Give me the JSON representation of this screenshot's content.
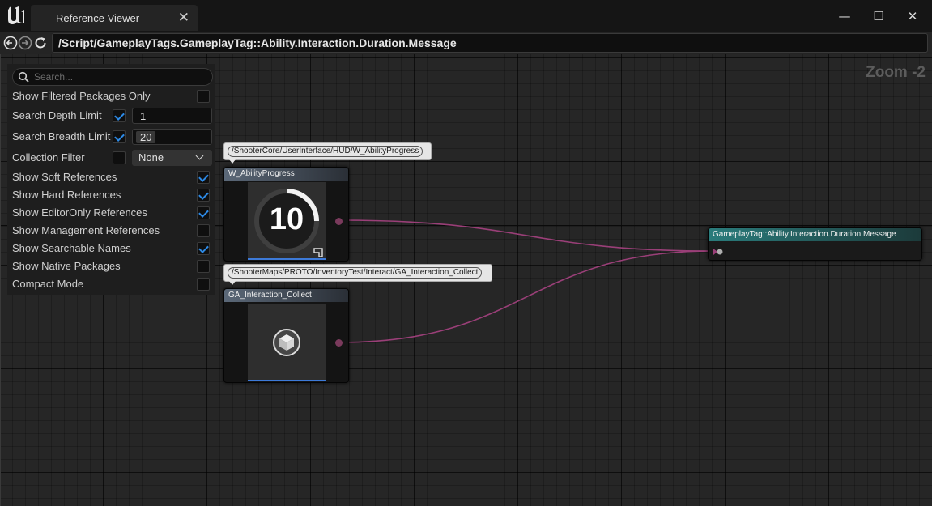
{
  "window": {
    "tab_title": "Reference Viewer",
    "close_tab": "✕",
    "minimize": "—",
    "maximize": "☐",
    "close": "✕"
  },
  "address": {
    "path": "/Script/GameplayTags.GameplayTag::Ability.Interaction.Duration.Message"
  },
  "graph": {
    "zoom_label": "Zoom -2"
  },
  "settings": {
    "search_placeholder": "Search...",
    "filtered_packages": {
      "label": "Show Filtered Packages Only",
      "checked": false
    },
    "depth_limit": {
      "label": "Search Depth Limit",
      "checked": true,
      "value": "1"
    },
    "breadth_limit": {
      "label": "Search Breadth Limit",
      "checked": true,
      "value": "20"
    },
    "collection_filter": {
      "label": "Collection Filter",
      "checked": false,
      "value": "None"
    },
    "soft_refs": {
      "label": "Show Soft References",
      "checked": true
    },
    "hard_refs": {
      "label": "Show Hard References",
      "checked": true
    },
    "editor_only_refs": {
      "label": "Show EditorOnly References",
      "checked": true
    },
    "management_refs": {
      "label": "Show Management References",
      "checked": false
    },
    "searchable_names": {
      "label": "Show Searchable Names",
      "checked": true
    },
    "native_packages": {
      "label": "Show Native Packages",
      "checked": false
    },
    "compact_mode": {
      "label": "Compact Mode",
      "checked": false
    }
  },
  "nodes": {
    "ability_progress": {
      "path": "/ShooterCore/UserInterface/HUD/W_AbilityProgress",
      "title": "W_AbilityProgress",
      "thumb_value": "10"
    },
    "interaction_collect": {
      "path": "/ShooterMaps/PROTO/InventoryTest/Interact/GA_Interaction_Collect",
      "title": "GA_Interaction_Collect"
    },
    "gameplay_tag": {
      "title": "GameplayTag::Ability.Interaction.Duration.Message"
    }
  },
  "colors": {
    "accent_blue": "#2d8ae6",
    "wire": "#9a3f78",
    "tag_header": "#2a7c7c"
  }
}
